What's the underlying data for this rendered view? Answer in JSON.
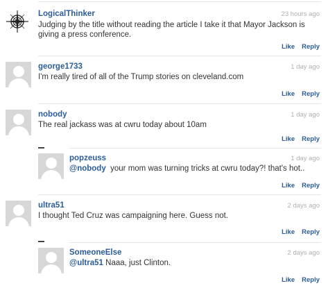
{
  "comments": [
    {
      "author": "LogicalThinker",
      "time": "23 hours ago",
      "text": "Judging by the title without reading the article I take it that Mayor Jackson is giving a press conference.",
      "like": "Like",
      "reply": "Reply"
    },
    {
      "author": "george1733",
      "time": "1 day ago",
      "text": "I'm really tired of all of the Trump stories on cleveland.com",
      "like": "Like",
      "reply": "Reply"
    },
    {
      "author": "nobody",
      "time": "1 day ago",
      "text": "The real jackass was at cwru today about 10am",
      "like": "Like",
      "reply": "Reply"
    },
    {
      "author": "popzeuss",
      "time": "1 day ago",
      "mention": "@nobody",
      "text": "your mom was turning tricks at cwru today?! that's hot..",
      "like": "Like",
      "reply": "Reply"
    },
    {
      "author": "ultra51",
      "time": "2 days ago",
      "text": "I thought Ted Cruz was campaigning here.  Guess not.",
      "like": "Like",
      "reply": "Reply"
    },
    {
      "author": "SomeoneElse",
      "time": "2 days ago",
      "mention": "@ultra51",
      "text": "Naaa, just Clinton.",
      "like": "Like",
      "reply": "Reply"
    }
  ],
  "icons": {
    "compass_avatar": "compass-icon",
    "default_avatar": "user-avatar-icon",
    "collapse": "collapse-icon"
  },
  "colors": {
    "link": "#2b5d9b",
    "timestamp": "#b0b0b0",
    "avatar_bg": "#d7d7d7",
    "divider": "#e6e6e6"
  }
}
